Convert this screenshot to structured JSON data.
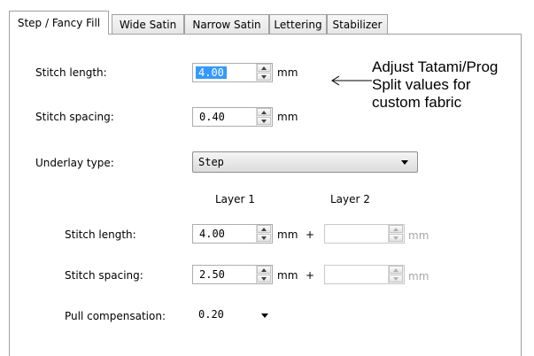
{
  "tabs": [
    {
      "label": "Step / Fancy Fill",
      "active": true
    },
    {
      "label": "Wide Satin",
      "active": false
    },
    {
      "label": "Narrow Satin",
      "active": false
    },
    {
      "label": "Lettering",
      "active": false
    },
    {
      "label": "Stabilizer",
      "active": false
    }
  ],
  "fields": {
    "stitch_length": {
      "label": "Stitch length:",
      "value": "4.00",
      "unit": "mm"
    },
    "stitch_spacing": {
      "label": "Stitch spacing:",
      "value": "0.40",
      "unit": "mm"
    },
    "underlay_type": {
      "label": "Underlay type:",
      "value": "Step"
    }
  },
  "layers": {
    "layer1": "Layer 1",
    "layer2": "Layer 2"
  },
  "underlay": {
    "stitch_length": {
      "label": "Stitch length:",
      "value": "4.00",
      "unit": "mm",
      "plus": "+",
      "value2": "",
      "unit2": "mm"
    },
    "stitch_spacing": {
      "label": "Stitch spacing:",
      "value": "2.50",
      "unit": "mm",
      "plus": "+",
      "value2": "",
      "unit2": "mm"
    },
    "pull_compensation": {
      "label": "Pull compensation:",
      "value": "0.20"
    }
  },
  "annotation": {
    "line1": "Adjust Tatami/Prog",
    "line2": "Split values for",
    "line3": "custom fabric"
  }
}
